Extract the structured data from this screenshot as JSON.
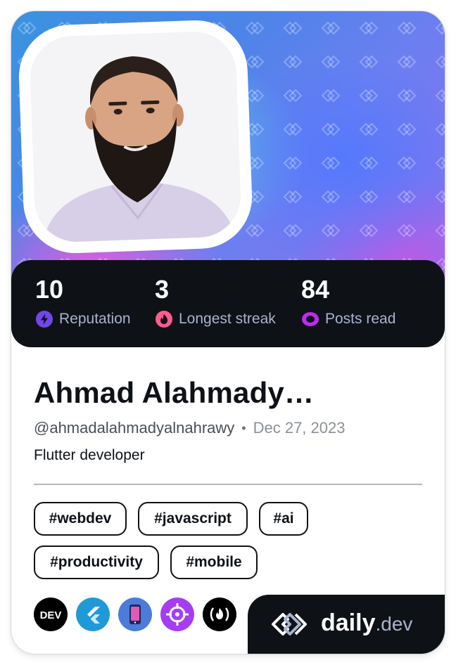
{
  "profile": {
    "name": "Ahmad Alahmady…",
    "handle": "@ahmadalahmadyalnahrawy",
    "separator": "•",
    "joined_date": "Dec 27, 2023",
    "bio": "Flutter developer"
  },
  "stats": [
    {
      "value": "10",
      "label": "Reputation",
      "icon": "lightning-icon",
      "color": "#7147ed"
    },
    {
      "value": "3",
      "label": "Longest streak",
      "icon": "flame-icon",
      "color": "#ff5c8d"
    },
    {
      "value": "84",
      "label": "Posts read",
      "icon": "eye-ring-icon",
      "color": "#c029f0"
    }
  ],
  "tags": [
    "#webdev",
    "#javascript",
    "#ai",
    "#productivity",
    "#mobile"
  ],
  "sources": [
    {
      "name": "DEV",
      "label": "DEV",
      "color": "#000000"
    },
    {
      "name": "flutter",
      "label": "",
      "color": "#1f9ad6"
    },
    {
      "name": "mobile-app",
      "label": "",
      "color": "#4c7bd9"
    },
    {
      "name": "crosshair",
      "label": "",
      "color": "#a43ef0"
    },
    {
      "name": "freecodecamp",
      "label": "(🔥)",
      "color": "#000000"
    }
  ],
  "brand": {
    "word": "daily",
    "suffix": ".dev"
  },
  "colors": {
    "card_dark": "#0e1217",
    "muted": "#a8b3cf"
  }
}
